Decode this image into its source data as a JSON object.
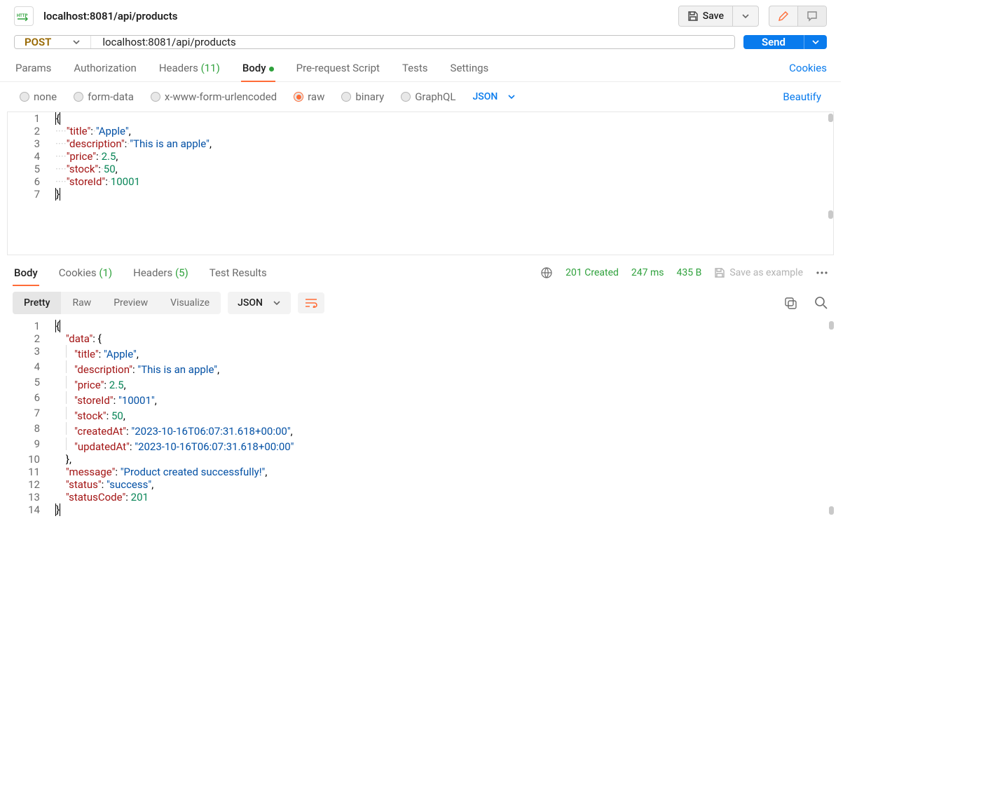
{
  "header": {
    "title": "localhost:8081/api/products",
    "save_label": "Save"
  },
  "request": {
    "method": "POST",
    "url": "localhost:8081/api/products",
    "send_label": "Send",
    "tabs": {
      "params": "Params",
      "authorization": "Authorization",
      "headers": "Headers",
      "headers_count": "(11)",
      "body": "Body",
      "prerequest": "Pre-request Script",
      "tests": "Tests",
      "settings": "Settings"
    },
    "cookies_link": "Cookies",
    "body_types": {
      "none": "none",
      "formdata": "form-data",
      "xwww": "x-www-form-urlencoded",
      "raw": "raw",
      "binary": "binary",
      "graphql": "GraphQL"
    },
    "format_select": "JSON",
    "beautify": "Beautify",
    "body_json": {
      "title": "Apple",
      "description": "This is an apple",
      "price": 2.5,
      "stock": 50,
      "storeId": 10001
    }
  },
  "response": {
    "tabs": {
      "body": "Body",
      "cookies": "Cookies",
      "cookies_count": "(1)",
      "headers": "Headers",
      "headers_count": "(5)",
      "test_results": "Test Results"
    },
    "status": "201 Created",
    "time": "247 ms",
    "size": "435 B",
    "save_example": "Save as example",
    "view_modes": {
      "pretty": "Pretty",
      "raw": "Raw",
      "preview": "Preview",
      "visualize": "Visualize"
    },
    "format_select": "JSON",
    "body_json": {
      "data": {
        "title": "Apple",
        "description": "This is an apple",
        "price": 2.5,
        "storeId": "10001",
        "stock": 50,
        "createdAt": "2023-10-16T06:07:31.618+00:00",
        "updatedAt": "2023-10-16T06:07:31.618+00:00"
      },
      "message": "Product created successfully!",
      "status": "success",
      "statusCode": 201
    }
  }
}
